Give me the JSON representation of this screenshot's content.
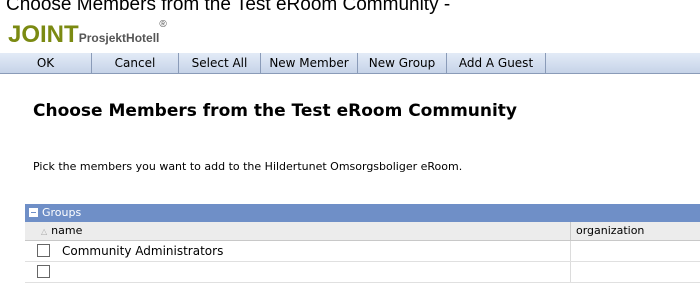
{
  "window": {
    "title": "Choose Members from the Test eRoom Community - "
  },
  "brand": {
    "logo_main": "JOINT",
    "logo_sub": "ProsjektHotell",
    "logo_mark": "®"
  },
  "toolbar": {
    "buttons": [
      "OK",
      "Cancel",
      "Select All",
      "New Member",
      "New Group",
      "Add A Guest"
    ]
  },
  "page": {
    "heading": "Choose Members from the Test eRoom Community",
    "instructions": "Pick the members you want to add to the Hildertunet Omsorgsboliger eRoom."
  },
  "groups_panel": {
    "title": "Groups",
    "columns": {
      "name": "name",
      "organization": "organization"
    },
    "rows": [
      {
        "name": "Community Administrators",
        "organization": ""
      }
    ]
  },
  "colors": {
    "logo_green": "#7b8a12",
    "header_blue": "#6f8fc7",
    "toolbar": "#c6d3e8"
  }
}
